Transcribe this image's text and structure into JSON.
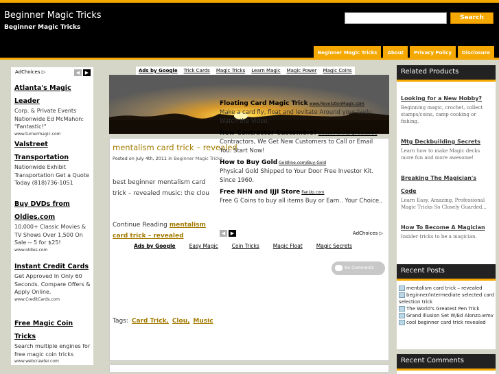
{
  "header": {
    "site_title": "Beginner Magic Tricks",
    "site_description": "Beginner Magic Tricks",
    "search_button": "Search",
    "nav": [
      "Beginner Magic Tricks",
      "About",
      "Privacy Policy",
      "Disclosure"
    ]
  },
  "left_ads": {
    "adchoices": "AdChoices ▷",
    "ads": [
      {
        "title": "Atlanta's Magic Leader",
        "body": "Corp. & Private Events Nationwide Ed McMahon: \"Fantastic!\"",
        "url": "www.turnermagic.com"
      },
      {
        "title": "Valstreet Transportation",
        "body": "Nationwide Exhibit Transportation Get a Quote Today (818)736-1051",
        "url": ""
      },
      {
        "title": "Buy DVDs from Oldies.com",
        "body": "10,000+ Classic Movies & TV Shows Over 1,500 On Sale -- 5 for $25!",
        "url": "www.oldies.com"
      },
      {
        "title": "Instant Credit Cards",
        "body": "Get Approved In Only 60 Seconds. Compare Offers & Apply Online.",
        "url": "www.CreditCards.com"
      },
      {
        "title": "Free Magic Coin Tricks",
        "body": "Search multiple engines for free magic coin tricks",
        "url": "www.webcrawler.com"
      }
    ]
  },
  "top_ad_links": {
    "ads_by": "Ads by Google",
    "links": [
      "Trick Cards",
      "Magic Tricks",
      "Learn Magic",
      "Magic Power",
      "Magic Coins"
    ]
  },
  "post": {
    "title": "mentalism card trick – revealed",
    "meta_prefix": "Posted on July 4th, 2011 in",
    "meta_category": "Beginner Magic Tricks",
    "excerpt": "best beginner mentalism card trick – revealed music: the clou",
    "continue_prefix": "Continue Reading",
    "continue_link": "mentalism card trick – revealed",
    "tags_label": "Tags:",
    "tags": [
      "Card Trick,",
      "Clou,",
      "Music"
    ],
    "comments": "No Comments"
  },
  "inner_ads": {
    "ads": [
      {
        "title": "Floating Card Magic Trick",
        "url": "www.RevolutionMagic.com",
        "body": "Make a card fly, float and levitate Around your body. Watch the Video."
      },
      {
        "title": "New Contractor Customers?",
        "url": "Deluxe.MerchEngines.com/C",
        "body": "Contractors, We Get New Customers to Call or Email You. Start Now!"
      },
      {
        "title": "How to Buy Gold",
        "url": "Goldline.com/Buy-Gold",
        "body": "Physical Gold Shipped to Your Door Free Investor Kit. Since 1960."
      },
      {
        "title": "Free NHN and IJJI Store",
        "url": "FanUp.com",
        "body": "Free G Coins to buy all items Buy or Earn.. Your Choice.."
      }
    ],
    "adchoices": "AdChoices ▷"
  },
  "bottom_ad_links": {
    "ads_by": "Ads by Google",
    "links": [
      "Easy Magic",
      "Coin Tricks",
      "Magic Float",
      "Magic Secrets"
    ]
  },
  "next_post_snippet": "beginner/intermediate selected card selection trick",
  "sidebar": {
    "related_heading": "Related Products",
    "products": [
      {
        "title": "Looking for a New Hobby?",
        "desc": "Beginning magic, crochet, collect stamps/coins, camp cooking or fishing."
      },
      {
        "title": "Mtg Deckbuilding Secrets",
        "desc": "Learn how to make Magic decks more fun and more awesome!"
      },
      {
        "title": "Breaking The Magician's Code",
        "desc": "Learn Easy, Amazing, Professional Magic Tricks So Closely Guarded..."
      },
      {
        "title": "How To Become A Magician",
        "desc": "Insider tricks to be a magician."
      }
    ],
    "recent_posts_heading": "Recent Posts",
    "recent_posts": [
      "mentalism card trick – revealed",
      "beginner/intermediate selected card selection trick",
      "The World's Greatest Pen Trick",
      "Grand Illusion Set W/Ed Alonzo.wmv",
      "cool beginner card trick revealed"
    ],
    "recent_comments_heading": "Recent Comments"
  },
  "colors": {
    "accent": "#f5a800",
    "header_bg": "#000000",
    "page_bg": "#d6d6c8",
    "link_gold": "#a37a00"
  }
}
